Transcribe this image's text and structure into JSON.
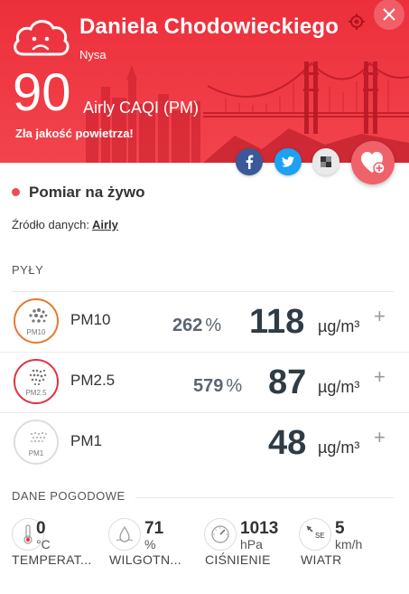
{
  "header": {
    "station_name": "Daniela Chodowieckiego",
    "city": "Nysa",
    "aqi_value": "90",
    "aqi_label": "Airly CAQI (PM)",
    "quality_text": "Zła jakość powietrza!",
    "background_color": "#ee3a45"
  },
  "live": {
    "label": "Pomiar na żywo",
    "source_prefix": "Źródło danych:",
    "source_link": "Airly"
  },
  "dust": {
    "section_title": "PYŁY",
    "items": [
      {
        "name": "PM10",
        "icon_label": "PM10",
        "percent": "262",
        "percent_sign": "%",
        "value": "118",
        "unit": "µg/m³",
        "color": "#e8792c"
      },
      {
        "name": "PM2.5",
        "icon_label": "PM2.5",
        "percent": "579",
        "percent_sign": "%",
        "value": "87",
        "unit": "µg/m³",
        "color": "#e3323d"
      },
      {
        "name": "PM1",
        "icon_label": "PM1",
        "percent": "",
        "percent_sign": "",
        "value": "48",
        "unit": "µg/m³",
        "color": "#dddddd"
      }
    ],
    "plus": "+"
  },
  "weather": {
    "section_title": "DANE POGODOWE",
    "items": [
      {
        "value": "0",
        "unit": "°C",
        "name": "TEMPERAT..."
      },
      {
        "value": "71",
        "unit": "%",
        "name": "WILGOTN..."
      },
      {
        "value": "1013",
        "unit": "hPa",
        "name": "CIŚNIENIE"
      },
      {
        "value": "5",
        "unit": "km/h",
        "name": "WIATR",
        "direction": "SE"
      }
    ]
  }
}
